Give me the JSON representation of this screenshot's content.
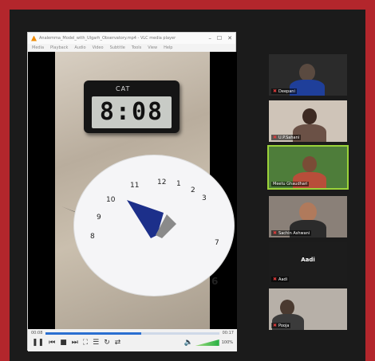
{
  "player": {
    "title": "Analemma_Model_with_Ulgarh_Observatory.mp4 - VLC media player",
    "menus": [
      "Media",
      "Playback",
      "Audio",
      "Video",
      "Subtitle",
      "Tools",
      "View",
      "Help"
    ],
    "clock_top": "CAT",
    "clock_time": "8:08",
    "time_elapsed": "00:08",
    "time_total": "00:17",
    "progress_fraction": 0.55,
    "volume_label": "100%",
    "dial_numbers": [
      "8",
      "9",
      "10",
      "11",
      "12",
      "1",
      "2",
      "3",
      "7",
      "6"
    ]
  },
  "participants": [
    {
      "name": "Deepani",
      "video": true
    },
    {
      "name": "U.P.Sahani",
      "video": true
    },
    {
      "name": "Meetu Ghaudhari",
      "video": true,
      "active": true
    },
    {
      "name": "Sachin Ashwani",
      "video": true
    },
    {
      "name": "Aadi",
      "video": false,
      "label": "Aadi"
    },
    {
      "name": "Pooja",
      "video": true
    }
  ],
  "colors": {
    "frame": "#b3262c",
    "active_border": "#9bd33a",
    "seek_fill": "#2a6fd1"
  }
}
